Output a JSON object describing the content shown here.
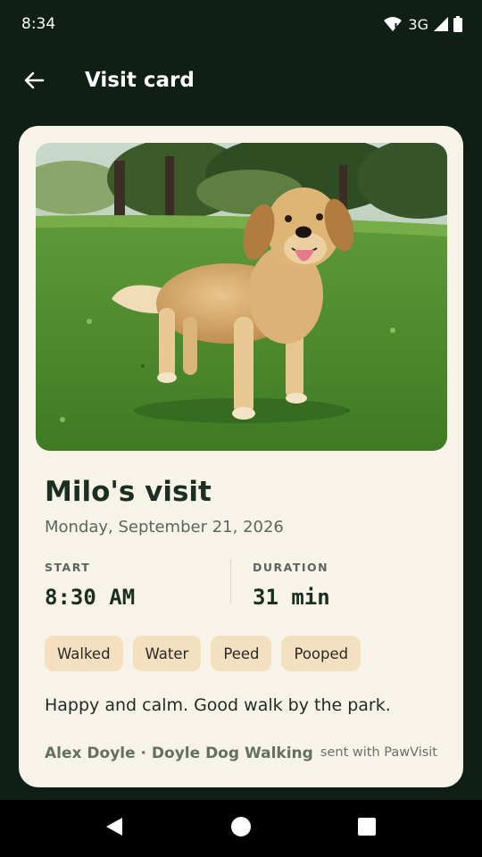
{
  "status_bar": {
    "time": "8:34",
    "network": "3G",
    "icons": [
      "wifi-alert-icon",
      "cellular-signal-icon",
      "battery-icon"
    ]
  },
  "top_bar": {
    "title": "Visit card",
    "back_icon": "arrow-left-icon"
  },
  "card": {
    "photo": {
      "subject": "golden retriever dog standing on grass in a park",
      "icon": "dog-photo"
    },
    "title": "Milo's visit",
    "date": "Monday, September 21, 2026",
    "stats": [
      {
        "label": "START",
        "value": "8:30 AM"
      },
      {
        "label": "DURATION",
        "value": "31 min"
      }
    ],
    "tags": [
      "Walked",
      "Water",
      "Peed",
      "Pooped"
    ],
    "note": "Happy and calm. Good walk by the park.",
    "walker": "Alex Doyle · Doyle Dog Walking",
    "sent_with": "sent with PawVisit"
  },
  "nav_bar": {
    "buttons": [
      "back-triangle-icon",
      "home-circle-icon",
      "recents-square-icon"
    ]
  },
  "colors": {
    "background": "#0f1f16",
    "card": "#f8f3e9",
    "tag": "#f2e0c0",
    "title_text": "#1b2e22"
  }
}
